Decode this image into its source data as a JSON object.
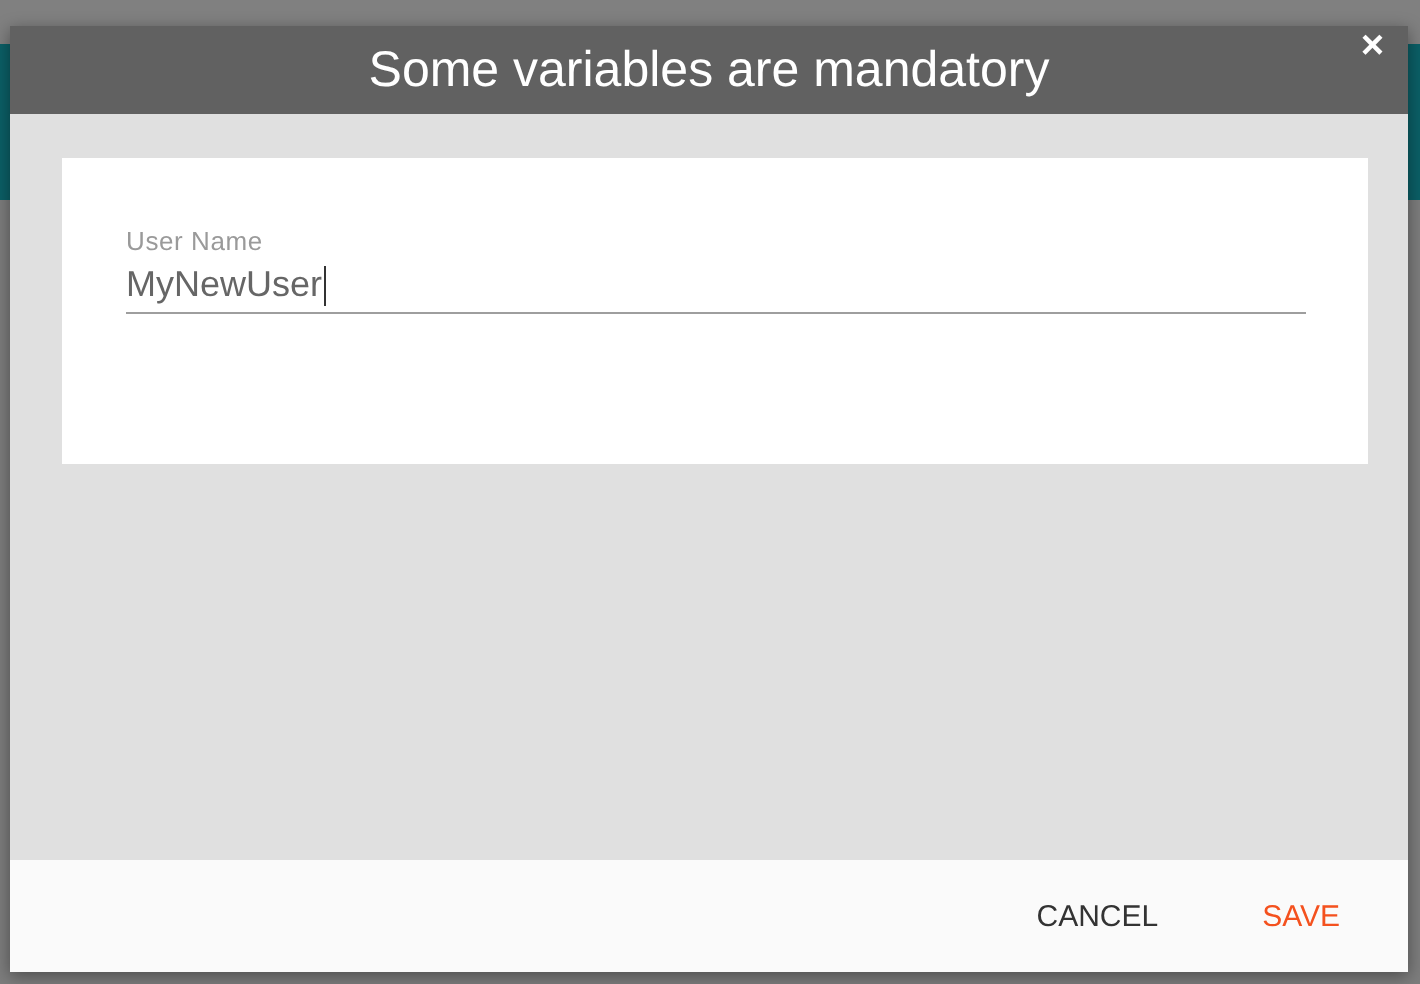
{
  "dialog": {
    "title": "Some variables are mandatory",
    "close": "×",
    "fields": [
      {
        "label": "User Name",
        "value": "MyNewUser",
        "focused": true
      }
    ],
    "buttons": [
      {
        "label": "CANCEL",
        "kind": "secondary"
      },
      {
        "label": "SAVE",
        "kind": "primary"
      }
    ]
  }
}
